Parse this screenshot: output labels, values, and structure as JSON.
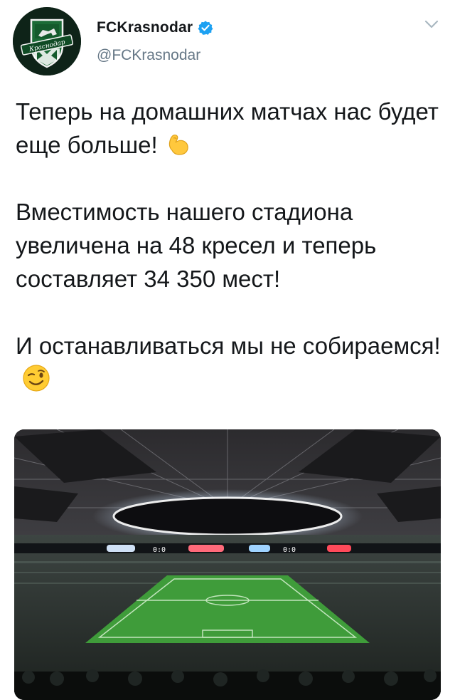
{
  "account": {
    "display_name": "FCKrasnodar",
    "handle": "@FCKrasnodar",
    "verified": true,
    "avatar_icon": "fc-krasnodar-crest",
    "avatar_text": "Краснодар"
  },
  "tweet": {
    "paragraphs": [
      {
        "text": "Теперь на домашних матчах нас будет еще больше!",
        "emoji": "flexed-biceps"
      },
      {
        "text": "Вместимость нашего стадиона увеличена на 48 кресел и теперь составляет 34 350 мест!",
        "emoji": null
      },
      {
        "text": "И останавливаться мы не собираемся!",
        "emoji": "winking-face"
      }
    ]
  },
  "media": {
    "type": "photo",
    "scoreboard_left": "0:0",
    "scoreboard_right": "0:0"
  },
  "colors": {
    "accent": "#1da1f2",
    "secondary_text": "#657786",
    "pitch": "#3f9c3a"
  }
}
